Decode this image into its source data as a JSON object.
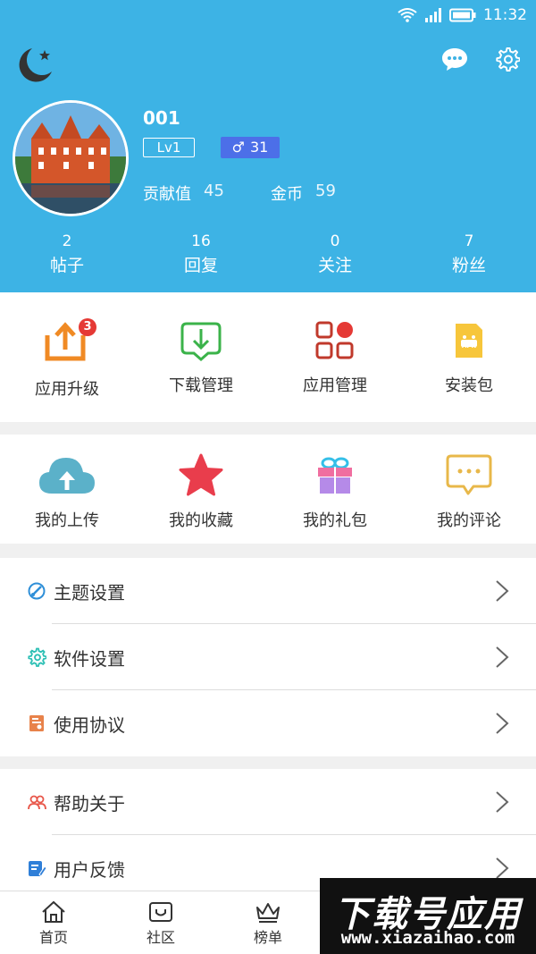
{
  "status": {
    "time": "11:32"
  },
  "profile": {
    "username": "001",
    "level": "Lv1",
    "gender_symbol": "♂",
    "age": "31",
    "contribution_label": "贡献值",
    "contribution_value": "45",
    "coins_label": "金币",
    "coins_value": "59"
  },
  "counts": [
    {
      "value": "2",
      "label": "帖子"
    },
    {
      "value": "16",
      "label": "回复"
    },
    {
      "value": "0",
      "label": "关注"
    },
    {
      "value": "7",
      "label": "粉丝"
    }
  ],
  "grid1": [
    {
      "label": "应用升级",
      "badge": "3",
      "icon": "upload-box-icon"
    },
    {
      "label": "下载管理",
      "icon": "download-tray-icon"
    },
    {
      "label": "应用管理",
      "icon": "app-grid-icon"
    },
    {
      "label": "安装包",
      "icon": "apk-icon",
      "icon_text": "APK"
    }
  ],
  "grid2": [
    {
      "label": "我的上传",
      "icon": "cloud-upload-icon"
    },
    {
      "label": "我的收藏",
      "icon": "star-icon"
    },
    {
      "label": "我的礼包",
      "icon": "gift-icon"
    },
    {
      "label": "我的评论",
      "icon": "comment-icon"
    }
  ],
  "menu1": [
    {
      "label": "主题设置",
      "icon": "palette-icon"
    },
    {
      "label": "软件设置",
      "icon": "gear-icon"
    },
    {
      "label": "使用协议",
      "icon": "agreement-icon"
    }
  ],
  "menu2": [
    {
      "label": "帮助关于",
      "icon": "people-icon"
    },
    {
      "label": "用户反馈",
      "icon": "feedback-icon"
    }
  ],
  "tabs": [
    {
      "label": "首页",
      "icon": "home-icon"
    },
    {
      "label": "社区",
      "icon": "community-icon"
    },
    {
      "label": "榜单",
      "icon": "crown-icon"
    },
    {
      "label": "",
      "icon": "hidden-tab-icon"
    },
    {
      "label": "",
      "icon": "hidden-tab-icon"
    }
  ],
  "watermark": {
    "title": "下载号应用",
    "url": "www.xiazaihao.com"
  },
  "colors": {
    "header": "#3db3e5",
    "badge": "#e53935",
    "accent_orange": "#f08a24"
  }
}
